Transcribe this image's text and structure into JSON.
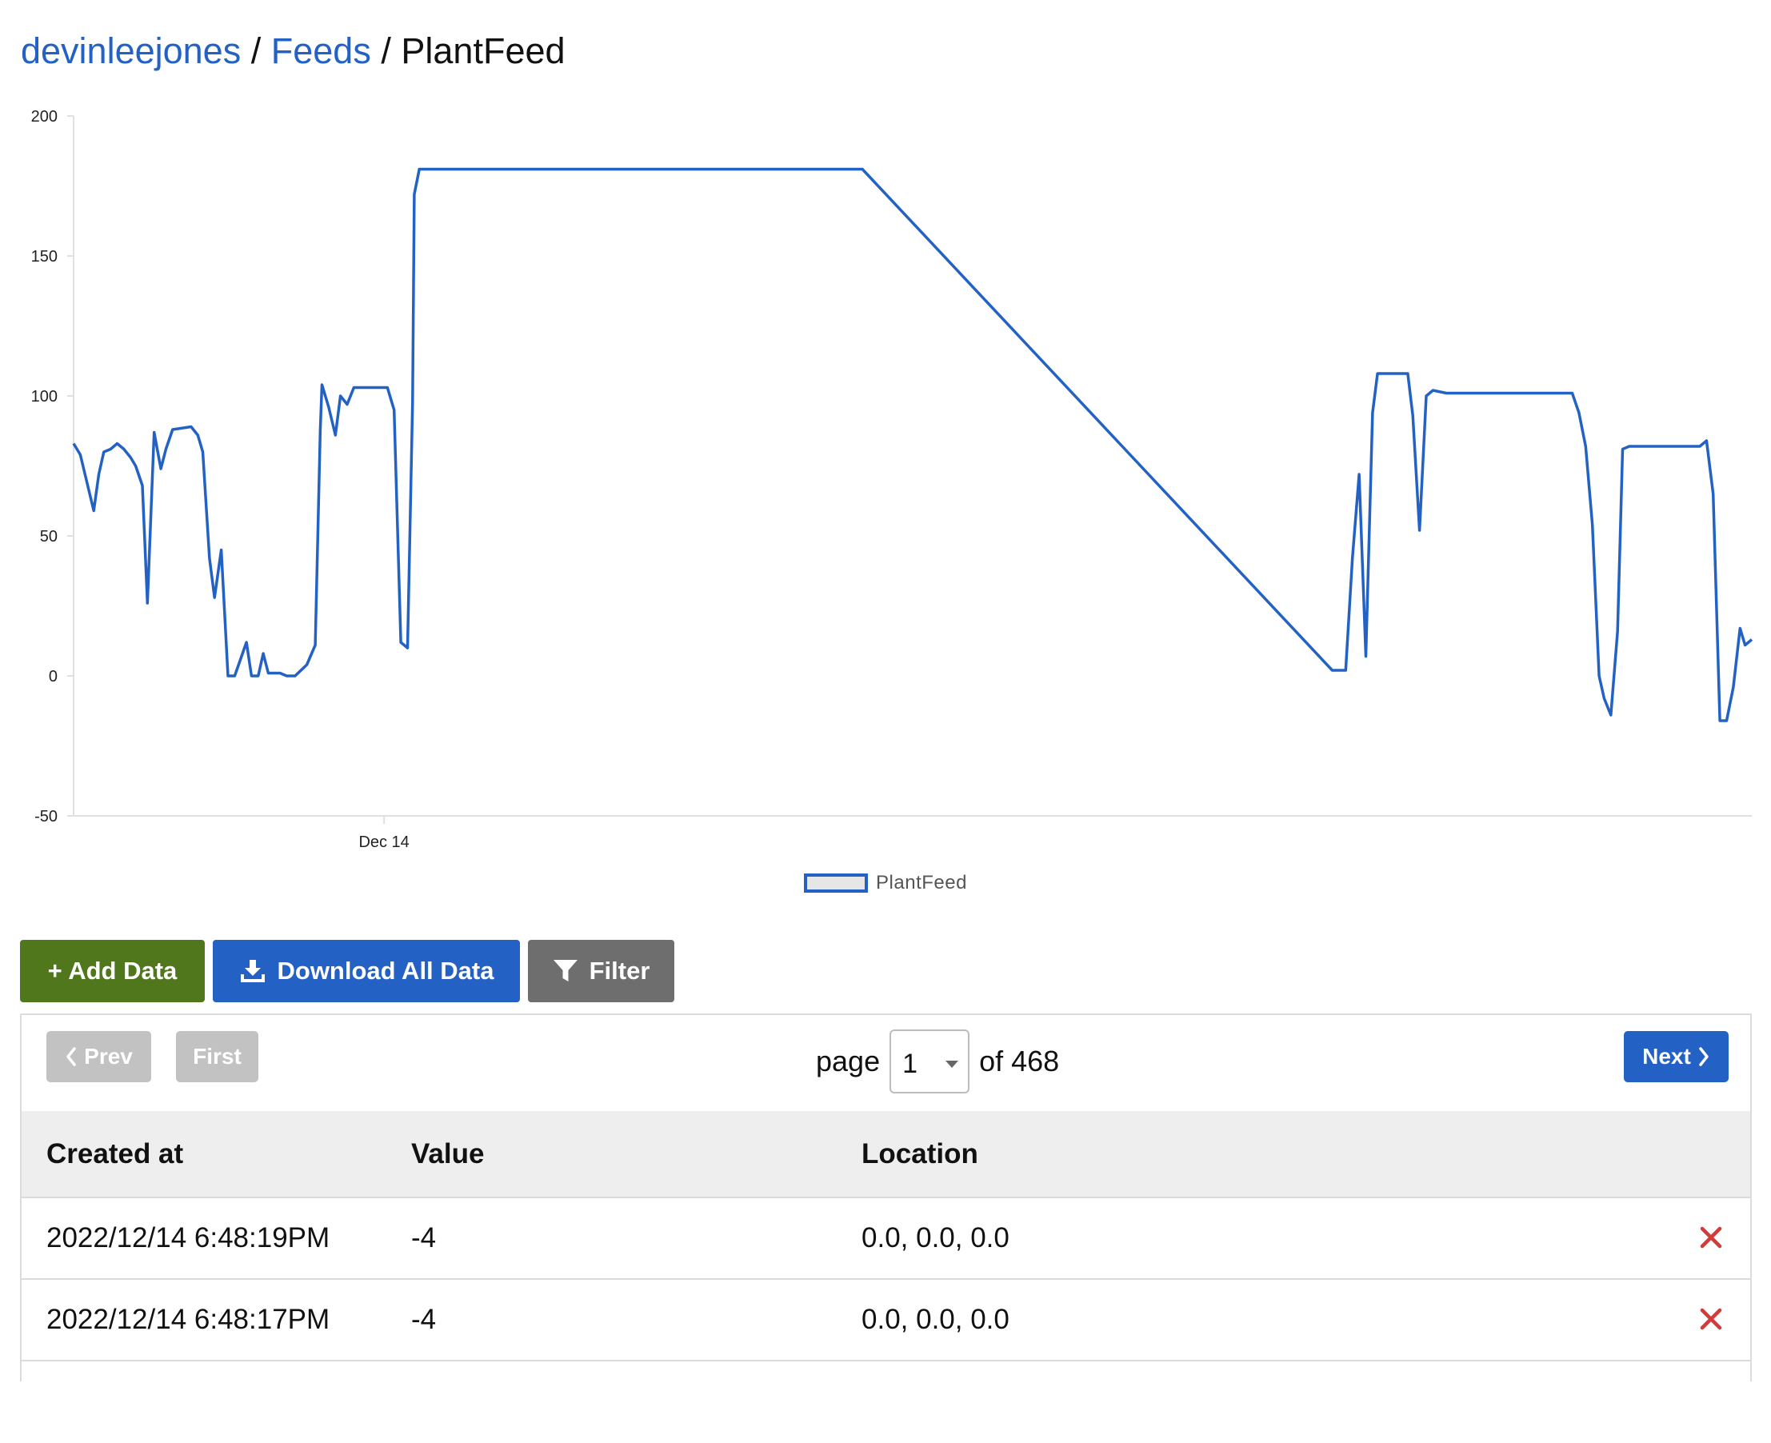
{
  "breadcrumb": {
    "user": "devinleejones",
    "sep1": "/",
    "feeds": "Feeds",
    "sep2": "/",
    "current": "PlantFeed"
  },
  "chart_data": {
    "type": "line",
    "title": "",
    "xlabel": "",
    "ylabel": "",
    "ylim": [
      -50,
      200
    ],
    "y_ticks": [
      "200",
      "150",
      "100",
      "50",
      "0",
      "-50"
    ],
    "x_ticks": [
      {
        "label": "Dec 14",
        "t": 0.185
      }
    ],
    "legend": {
      "position": "bottom-center"
    },
    "grid": false,
    "color": "#2362c4",
    "series": [
      {
        "name": "PlantFeed",
        "points": [
          [
            0.0,
            83
          ],
          [
            0.004,
            79
          ],
          [
            0.008,
            69
          ],
          [
            0.012,
            59
          ],
          [
            0.015,
            72
          ],
          [
            0.018,
            80
          ],
          [
            0.022,
            81
          ],
          [
            0.026,
            83
          ],
          [
            0.03,
            81
          ],
          [
            0.034,
            78
          ],
          [
            0.037,
            75
          ],
          [
            0.041,
            68
          ],
          [
            0.044,
            26
          ],
          [
            0.048,
            87
          ],
          [
            0.052,
            74
          ],
          [
            0.055,
            81
          ],
          [
            0.059,
            88
          ],
          [
            0.07,
            89
          ],
          [
            0.074,
            86
          ],
          [
            0.077,
            80
          ],
          [
            0.081,
            42
          ],
          [
            0.084,
            28
          ],
          [
            0.088,
            45
          ],
          [
            0.092,
            0
          ],
          [
            0.096,
            0
          ],
          [
            0.103,
            12
          ],
          [
            0.106,
            0
          ],
          [
            0.11,
            0
          ],
          [
            0.113,
            8
          ],
          [
            0.116,
            1
          ],
          [
            0.123,
            1
          ],
          [
            0.127,
            0
          ],
          [
            0.132,
            0
          ],
          [
            0.139,
            4
          ],
          [
            0.144,
            11
          ],
          [
            0.147,
            88
          ],
          [
            0.148,
            104
          ],
          [
            0.152,
            96
          ],
          [
            0.156,
            86
          ],
          [
            0.159,
            100
          ],
          [
            0.163,
            97
          ],
          [
            0.167,
            103
          ],
          [
            0.175,
            103
          ],
          [
            0.182,
            103
          ],
          [
            0.187,
            103
          ],
          [
            0.191,
            95
          ],
          [
            0.195,
            12
          ],
          [
            0.199,
            10
          ],
          [
            0.202,
            98
          ],
          [
            0.203,
            172
          ],
          [
            0.206,
            181
          ],
          [
            0.47,
            181
          ],
          [
            0.75,
            2
          ],
          [
            0.758,
            2
          ],
          [
            0.762,
            42
          ],
          [
            0.766,
            72
          ],
          [
            0.77,
            7
          ],
          [
            0.774,
            94
          ],
          [
            0.777,
            108
          ],
          [
            0.795,
            108
          ],
          [
            0.798,
            93
          ],
          [
            0.802,
            52
          ],
          [
            0.806,
            100
          ],
          [
            0.81,
            102
          ],
          [
            0.818,
            101
          ],
          [
            0.84,
            101
          ],
          [
            0.86,
            101
          ],
          [
            0.876,
            101
          ],
          [
            0.893,
            101
          ],
          [
            0.897,
            94
          ],
          [
            0.901,
            82
          ],
          [
            0.905,
            54
          ],
          [
            0.909,
            0
          ],
          [
            0.912,
            -8
          ],
          [
            0.916,
            -14
          ],
          [
            0.92,
            16
          ],
          [
            0.923,
            81
          ],
          [
            0.927,
            82
          ],
          [
            0.931,
            82
          ],
          [
            0.944,
            82
          ],
          [
            0.948,
            82
          ],
          [
            0.952,
            82
          ],
          [
            0.964,
            82
          ],
          [
            0.969,
            82
          ],
          [
            0.973,
            84
          ],
          [
            0.977,
            65
          ],
          [
            0.981,
            -16
          ],
          [
            0.985,
            -16
          ],
          [
            0.989,
            -4
          ],
          [
            0.993,
            17
          ],
          [
            0.996,
            11
          ],
          [
            1.0,
            13
          ]
        ]
      }
    ]
  },
  "legend_label": "PlantFeed",
  "toolbar": {
    "add": "+ Add Data",
    "download": "Download All Data",
    "filter": "Filter"
  },
  "pager": {
    "prev": "Prev",
    "first": "First",
    "page_label": "page",
    "page_value": "1",
    "of_label": "of 468",
    "next": "Next"
  },
  "table": {
    "headers": [
      "Created at",
      "Value",
      "Location"
    ],
    "rows": [
      {
        "created": "2022/12/14 6:48:19PM",
        "value": "-4",
        "location": "0.0, 0.0, 0.0"
      },
      {
        "created": "2022/12/14 6:48:17PM",
        "value": "-4",
        "location": "0.0, 0.0, 0.0"
      }
    ]
  },
  "colors": {
    "link": "#2362c4",
    "add_button": "#50771c",
    "download_button": "#2362c4",
    "filter_button": "#6e6e6e",
    "delete": "#d23b3b"
  },
  "icons": {
    "download": "download-icon",
    "filter": "filter-icon",
    "prev": "chevron-left-icon",
    "next": "chevron-right-icon",
    "delete": "close-icon"
  }
}
